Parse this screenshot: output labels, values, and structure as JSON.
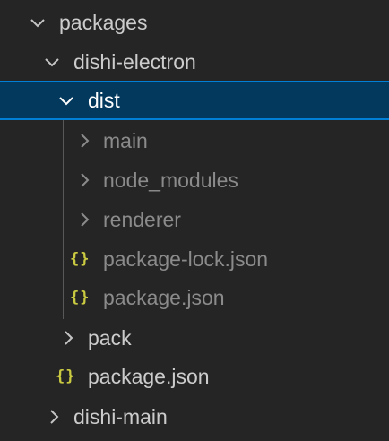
{
  "tree": {
    "items": [
      {
        "label": "packages",
        "icon": "chevron-down-icon"
      },
      {
        "label": "dishi-electron",
        "icon": "chevron-down-icon"
      },
      {
        "label": "dist",
        "icon": "chevron-down-icon",
        "selected": true
      },
      {
        "label": "main",
        "icon": "chevron-right-icon"
      },
      {
        "label": "node_modules",
        "icon": "chevron-right-icon"
      },
      {
        "label": "renderer",
        "icon": "chevron-right-icon"
      },
      {
        "label": "package-lock.json",
        "icon": "json-braces-icon"
      },
      {
        "label": "package.json",
        "icon": "json-braces-icon"
      },
      {
        "label": "pack",
        "icon": "chevron-right-icon"
      },
      {
        "label": "package.json",
        "icon": "json-braces-icon"
      },
      {
        "label": "dishi-main",
        "icon": "chevron-right-icon"
      }
    ],
    "json_icon_glyph": "{}"
  },
  "colors": {
    "background": "#252526",
    "selection": "#04395e",
    "selection_border": "#007fd4",
    "json_icon": "#cbcb41",
    "text": "#cccccc",
    "text_dim": "#8b8b8b"
  }
}
